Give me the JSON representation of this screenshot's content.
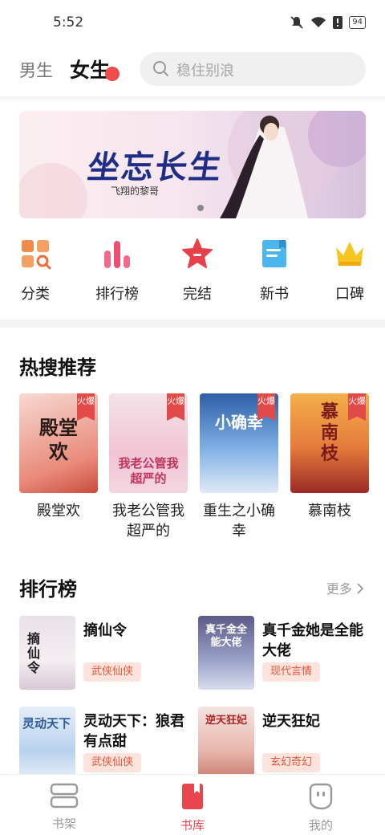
{
  "status_bar": {
    "time": "5:52",
    "battery": "94"
  },
  "header": {
    "tabs": [
      {
        "label": "男生"
      },
      {
        "label": "女生"
      }
    ],
    "search_placeholder": "稳住别浪"
  },
  "banner": {
    "title": "坐忘长生",
    "subtitle": "飞翔的黎哥"
  },
  "categories": [
    {
      "label": "分类",
      "icon": "grid-search-icon"
    },
    {
      "label": "排行榜",
      "icon": "bar-chart-icon"
    },
    {
      "label": "完结",
      "icon": "star-icon"
    },
    {
      "label": "新书",
      "icon": "book-icon"
    },
    {
      "label": "口碑",
      "icon": "crown-icon"
    }
  ],
  "hot_section": {
    "title": "热搜推荐",
    "badge": "火爆",
    "books": [
      {
        "name": "殿堂欢",
        "cover_text": "殿堂欢"
      },
      {
        "name": "我老公管我超严的",
        "cover_text": "我老公管我超严的"
      },
      {
        "name": "重生之小确幸",
        "cover_text": "小确幸"
      },
      {
        "name": "慕南枝",
        "cover_text": "慕南枝"
      }
    ]
  },
  "rank_section": {
    "title": "排行榜",
    "more": "更多",
    "items": [
      {
        "title": "摘仙令",
        "tag": "武侠仙侠",
        "cover_text": "摘仙令"
      },
      {
        "title": "真千金她是全能大佬",
        "tag": "现代言情",
        "cover_text": "真千金全能大佬"
      },
      {
        "title": "灵动天下：狼君有点甜",
        "tag": "武侠仙侠",
        "cover_text": "灵动天下"
      },
      {
        "title": "逆天狂妃",
        "tag": "玄幻奇幻",
        "cover_text": "逆天狂妃"
      }
    ]
  },
  "bottom_nav": [
    {
      "label": "书架",
      "icon": "bookshelf-icon"
    },
    {
      "label": "书库",
      "icon": "bookmark-book-icon"
    },
    {
      "label": "我的",
      "icon": "profile-icon"
    }
  ],
  "colors": {
    "accent": "#e8454f",
    "tag_bg": "#fde3dc",
    "tag_text": "#e0553a"
  }
}
